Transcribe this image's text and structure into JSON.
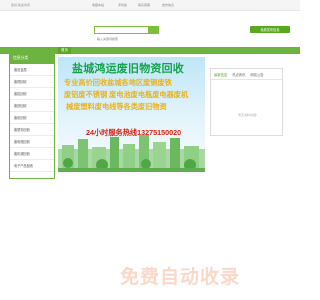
{
  "topbar": {
    "site_note": "您好,欢迎访问",
    "links": [
      "收藏本站",
      "手机版",
      "联系客服",
      "发布信息"
    ]
  },
  "header": {
    "search_placeholder": "输入关键词搜索",
    "publish_button": "免费发布信息"
  },
  "nav": {
    "home": "首页"
  },
  "sidebar": {
    "title": "信息分类",
    "items": [
      "废旧金属",
      "废铜回收",
      "废铝回收",
      "废铁回收",
      "废纸回收",
      "废塑料回收",
      "废电瓶回收",
      "废机械回收",
      "电子产品回收"
    ]
  },
  "banner": {
    "line1": "盐城鸿运废旧物资回收",
    "line2": "专业高价回收盐城各地区废铜废铁",
    "line3": "废铝废不锈钢 废电池废电瓶废电器废机",
    "line4": "械废塑料废电线等各类废旧物资",
    "line5": "24小时服务热线13275150020"
  },
  "panel": {
    "tabs": [
      "最新信息",
      "热点资讯",
      "网站公告"
    ],
    "empty_text": "暂无资料内容!"
  },
  "watermark": "免费自动收录"
}
